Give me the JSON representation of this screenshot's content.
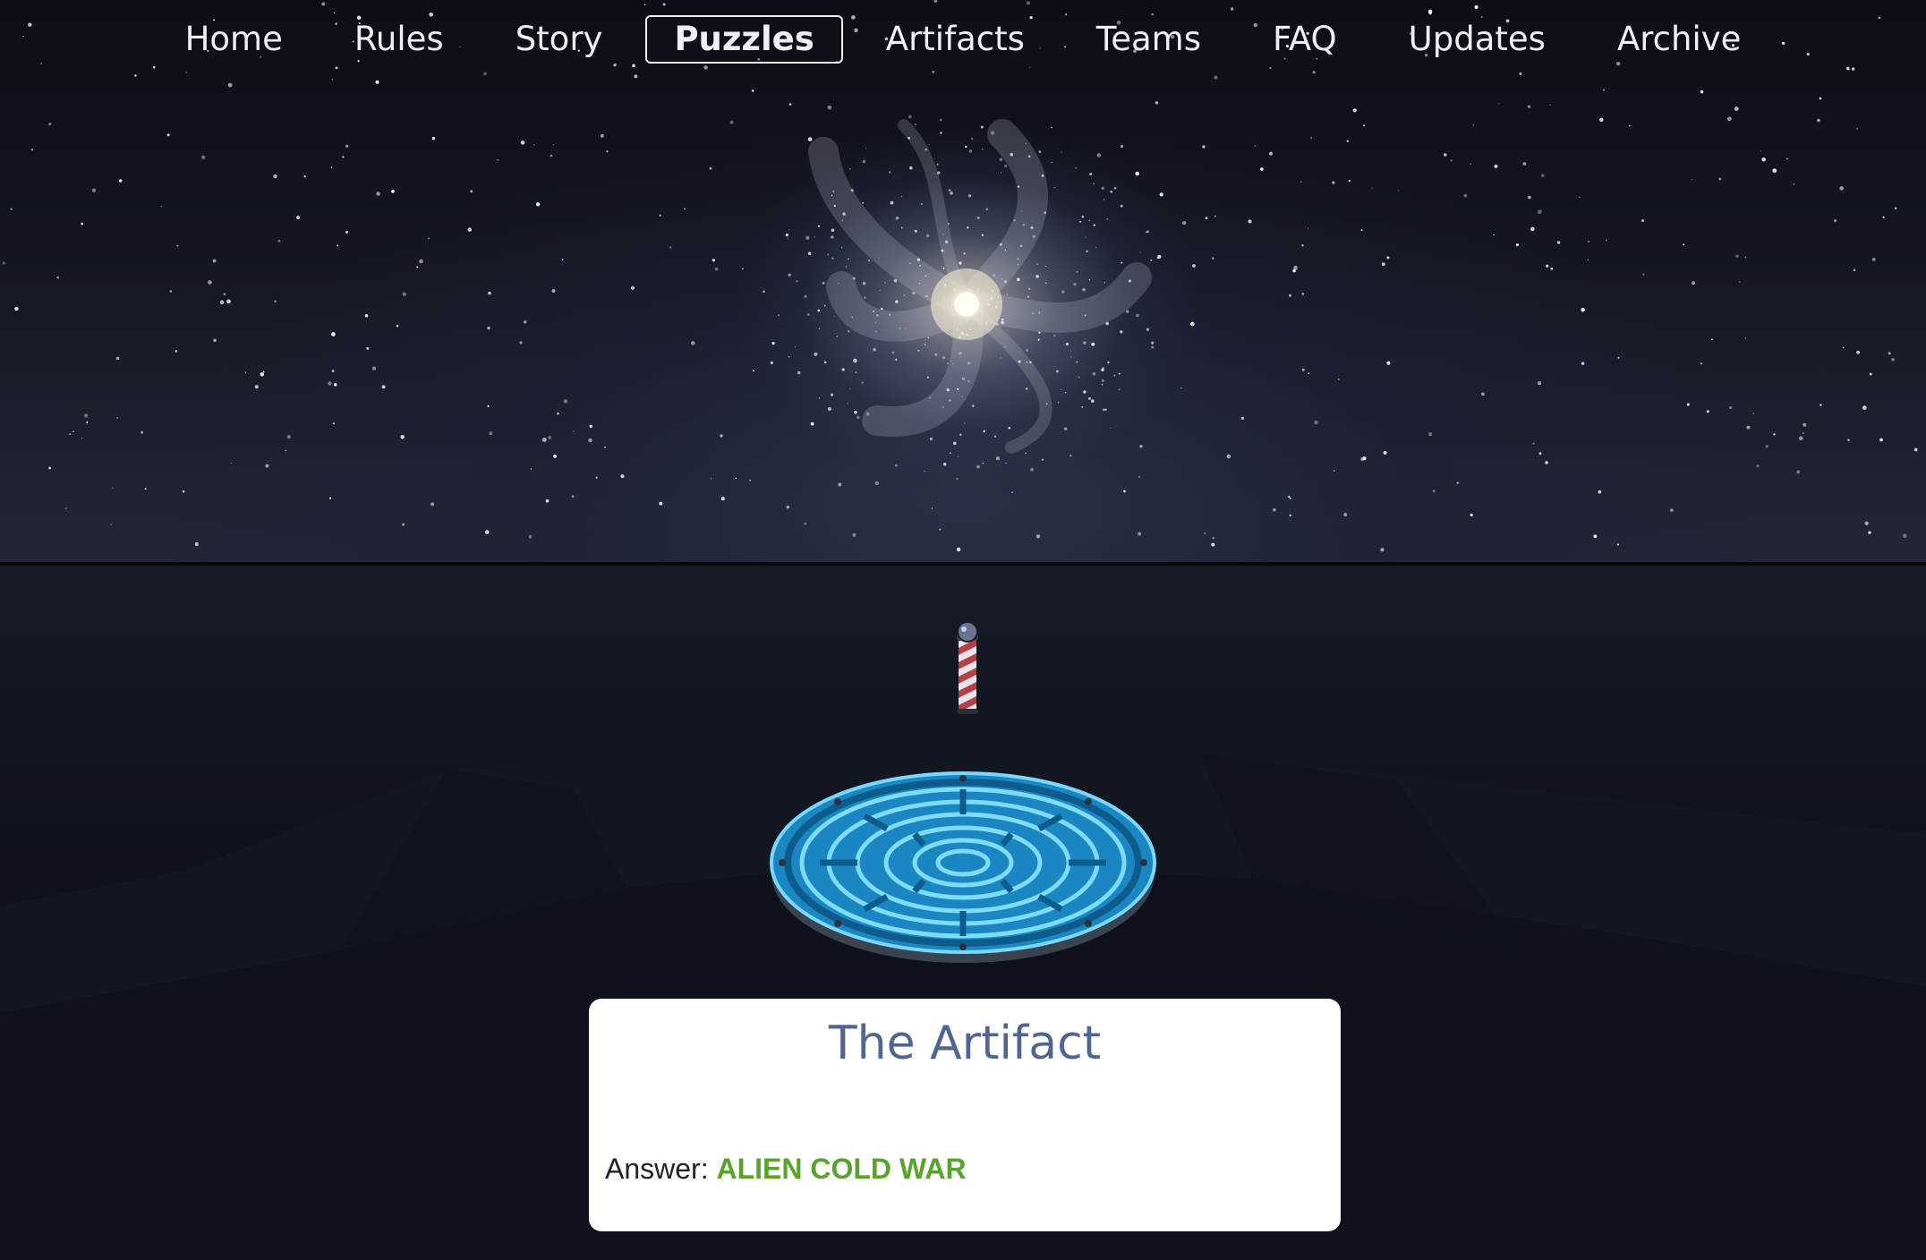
{
  "nav": {
    "items": [
      {
        "label": "Home"
      },
      {
        "label": "Rules"
      },
      {
        "label": "Story"
      },
      {
        "label": "Puzzles",
        "active": true
      },
      {
        "label": "Artifacts"
      },
      {
        "label": "Teams"
      },
      {
        "label": "FAQ"
      },
      {
        "label": "Updates"
      },
      {
        "label": "Archive"
      }
    ]
  },
  "scene": {
    "sky_color": "#0c0e15",
    "galaxy_core_color": "#fff0cd",
    "disc_glow_color": "#4fc3f0"
  },
  "card": {
    "title": "The Artifact",
    "answer_label": "Answer:",
    "answer_value": "ALIEN COLD WAR",
    "answer_color": "#58a32c",
    "title_color": "#4f6592"
  }
}
